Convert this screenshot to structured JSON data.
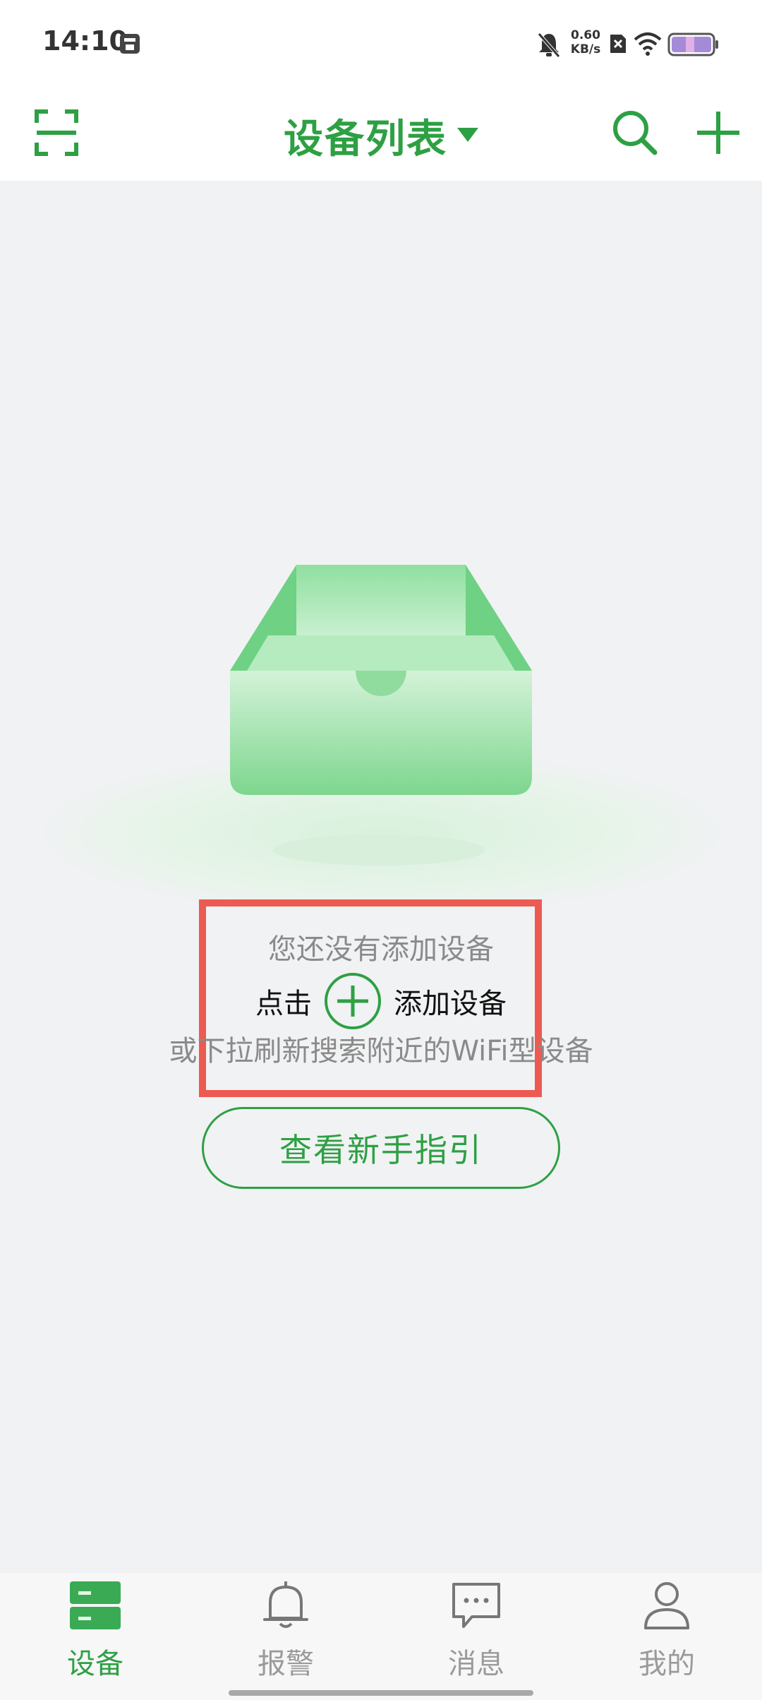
{
  "status_bar": {
    "time": "14:10",
    "net_speed_value": "0.60",
    "net_speed_unit": "KB/s"
  },
  "header": {
    "title": "设备列表",
    "icons": [
      "scan-icon",
      "caret-down-icon",
      "search-icon",
      "plus-icon"
    ]
  },
  "empty_state": {
    "line1": "您还没有添加设备",
    "line2_prefix": "点击",
    "line2_suffix": "添加设备",
    "line3": "或下拉刷新搜索附近的WiFi型设备",
    "guide_button": "查看新手指引"
  },
  "bottom_nav": {
    "items": [
      {
        "label": "设备",
        "icon": "device-icon",
        "active": true
      },
      {
        "label": "报警",
        "icon": "bell-icon",
        "active": false
      },
      {
        "label": "消息",
        "icon": "message-icon",
        "active": false
      },
      {
        "label": "我的",
        "icon": "user-icon",
        "active": false
      }
    ]
  },
  "colors": {
    "accent": "#2ea044",
    "highlight_box": "#ec5a52",
    "background": "#f1f2f4"
  }
}
